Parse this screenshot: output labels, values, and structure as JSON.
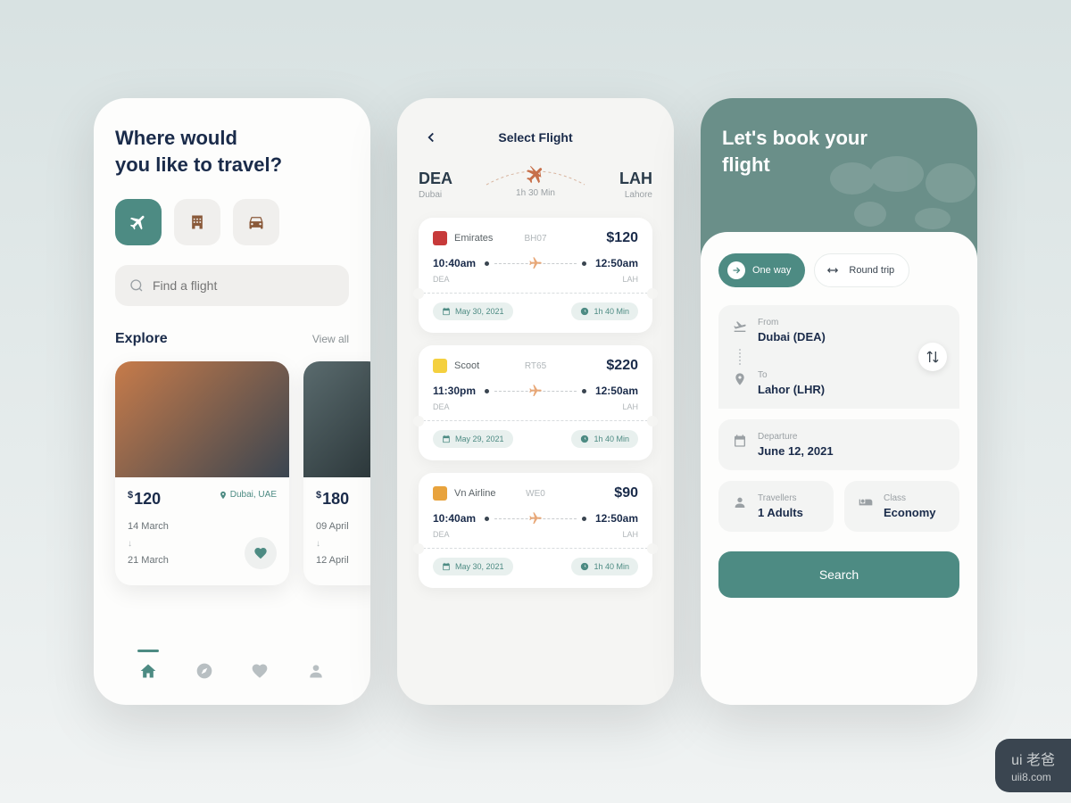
{
  "screen1": {
    "heading": "Where would\nyou like to travel?",
    "search_placeholder": "Find a flight",
    "explore_title": "Explore",
    "view_all": "View all",
    "cards": [
      {
        "price": "120",
        "location": "Dubai, UAE",
        "date_from": "14 March",
        "date_to": "21 March"
      },
      {
        "price": "180",
        "date_from": "09 April",
        "date_to": "12 April"
      }
    ]
  },
  "screen2": {
    "title": "Select Flight",
    "from_code": "DEA",
    "from_city": "Dubai",
    "to_code": "LAH",
    "to_city": "Lahore",
    "duration": "1h 30 Min",
    "flights": [
      {
        "airline": "Emirates",
        "logo_color": "#c73a3a",
        "code": "BH07",
        "price": "$120",
        "dep_time": "10:40am",
        "arr_time": "12:50am",
        "dep_code": "DEA",
        "arr_code": "LAH",
        "date": "May 30, 2021",
        "duration": "1h 40 Min"
      },
      {
        "airline": "Scoot",
        "logo_color": "#f4d03f",
        "code": "RT65",
        "price": "$220",
        "dep_time": "11:30pm",
        "arr_time": "12:50am",
        "dep_code": "DEA",
        "arr_code": "LAH",
        "date": "May 29, 2021",
        "duration": "1h 40 Min"
      },
      {
        "airline": "Vn Airline",
        "logo_color": "#e8a33d",
        "code": "WE0",
        "price": "$90",
        "dep_time": "10:40am",
        "arr_time": "12:50am",
        "dep_code": "DEA",
        "arr_code": "LAH",
        "date": "May 30, 2021",
        "duration": "1h 40 Min"
      }
    ]
  },
  "screen3": {
    "hero_title": "Let's book your\nflight",
    "trip_oneway": "One way",
    "trip_round": "Round trip",
    "from_label": "From",
    "from_value": "Dubai (DEA)",
    "to_label": "To",
    "to_value": "Lahor (LHR)",
    "departure_label": "Departure",
    "departure_value": "June 12, 2021",
    "travellers_label": "Travellers",
    "travellers_value": "1 Adults",
    "class_label": "Class",
    "class_value": "Economy",
    "search_btn": "Search"
  },
  "watermark": {
    "top": "ui 老爸",
    "bottom": "uii8.com"
  }
}
